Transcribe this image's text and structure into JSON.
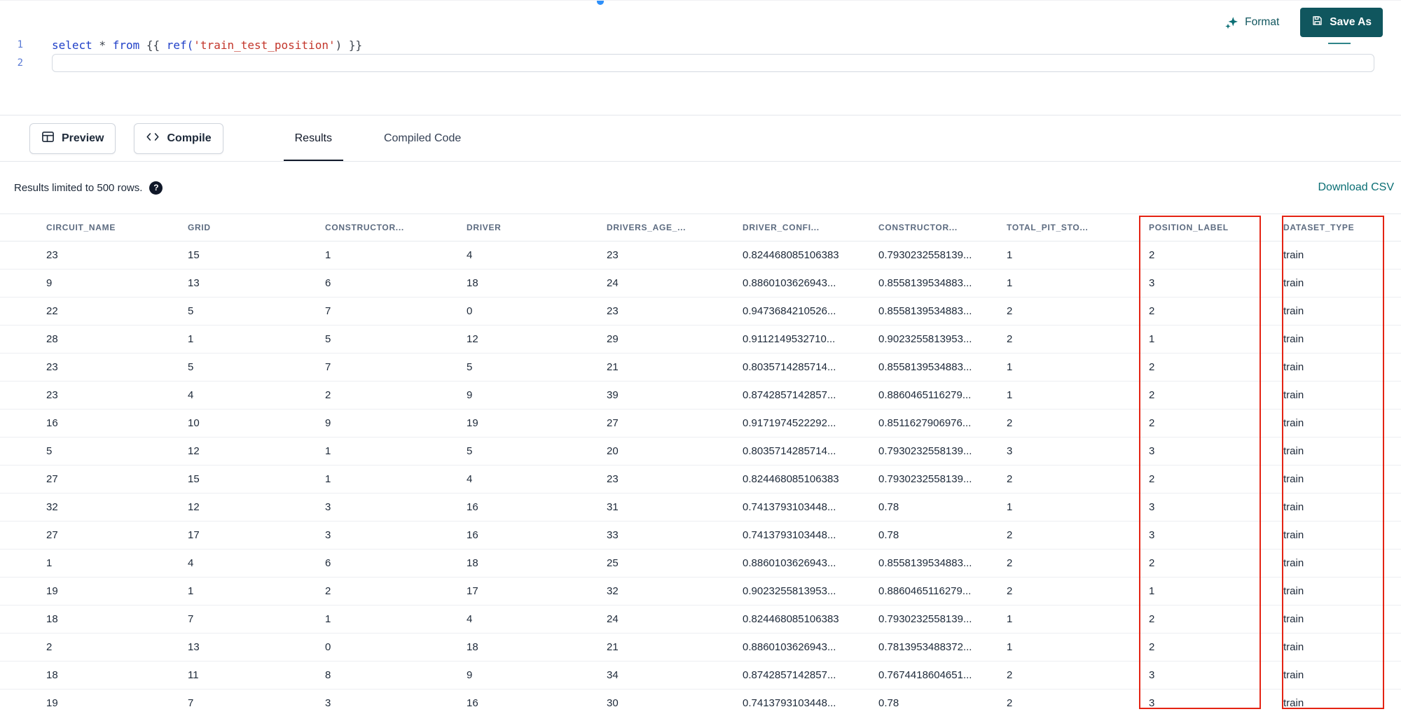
{
  "editor": {
    "actions": {
      "format_label": "Format",
      "save_as_label": "Save As"
    },
    "lines": [
      {
        "number": "1"
      },
      {
        "number": "2"
      }
    ],
    "code_tokens": [
      {
        "type": "keyword",
        "text": "select"
      },
      {
        "type": "plain",
        "text": " * "
      },
      {
        "type": "keyword",
        "text": "from"
      },
      {
        "type": "plain",
        "text": " {{ "
      },
      {
        "type": "function",
        "text": "ref("
      },
      {
        "type": "string",
        "text": "'train_test_position'"
      },
      {
        "type": "plain",
        "text": ") }}"
      }
    ]
  },
  "toolbar": {
    "preview_label": "Preview",
    "compile_label": "Compile",
    "tabs": [
      {
        "label": "Results",
        "active": true
      },
      {
        "label": "Compiled Code",
        "active": false
      }
    ]
  },
  "results": {
    "limit_note": "Results limited to 500 rows.",
    "help_icon": "?",
    "download_csv_label": "Download CSV",
    "columns": [
      "CIRCUIT_NAME",
      "GRID",
      "CONSTRUCTOR...",
      "DRIVER",
      "DRIVERS_AGE_...",
      "DRIVER_CONFI...",
      "CONSTRUCTOR...",
      "TOTAL_PIT_STO...",
      "POSITION_LABEL",
      "DATASET_TYPE"
    ],
    "rows": [
      [
        "23",
        "15",
        "1",
        "4",
        "23",
        "0.824468085106383",
        "0.7930232558139...",
        "1",
        "2",
        "train"
      ],
      [
        "9",
        "13",
        "6",
        "18",
        "24",
        "0.8860103626943...",
        "0.8558139534883...",
        "1",
        "3",
        "train"
      ],
      [
        "22",
        "5",
        "7",
        "0",
        "23",
        "0.9473684210526...",
        "0.8558139534883...",
        "2",
        "2",
        "train"
      ],
      [
        "28",
        "1",
        "5",
        "12",
        "29",
        "0.9112149532710...",
        "0.9023255813953...",
        "2",
        "1",
        "train"
      ],
      [
        "23",
        "5",
        "7",
        "5",
        "21",
        "0.8035714285714...",
        "0.8558139534883...",
        "1",
        "2",
        "train"
      ],
      [
        "23",
        "4",
        "2",
        "9",
        "39",
        "0.8742857142857...",
        "0.8860465116279...",
        "1",
        "2",
        "train"
      ],
      [
        "16",
        "10",
        "9",
        "19",
        "27",
        "0.9171974522292...",
        "0.8511627906976...",
        "2",
        "2",
        "train"
      ],
      [
        "5",
        "12",
        "1",
        "5",
        "20",
        "0.8035714285714...",
        "0.7930232558139...",
        "3",
        "3",
        "train"
      ],
      [
        "27",
        "15",
        "1",
        "4",
        "23",
        "0.824468085106383",
        "0.7930232558139...",
        "2",
        "2",
        "train"
      ],
      [
        "32",
        "12",
        "3",
        "16",
        "31",
        "0.7413793103448...",
        "0.78",
        "1",
        "3",
        "train"
      ],
      [
        "27",
        "17",
        "3",
        "16",
        "33",
        "0.7413793103448...",
        "0.78",
        "2",
        "3",
        "train"
      ],
      [
        "1",
        "4",
        "6",
        "18",
        "25",
        "0.8860103626943...",
        "0.8558139534883...",
        "2",
        "2",
        "train"
      ],
      [
        "19",
        "1",
        "2",
        "17",
        "32",
        "0.9023255813953...",
        "0.8860465116279...",
        "2",
        "1",
        "train"
      ],
      [
        "18",
        "7",
        "1",
        "4",
        "24",
        "0.824468085106383",
        "0.7930232558139...",
        "1",
        "2",
        "train"
      ],
      [
        "2",
        "13",
        "0",
        "18",
        "21",
        "0.8860103626943...",
        "0.7813953488372...",
        "1",
        "2",
        "train"
      ],
      [
        "18",
        "11",
        "8",
        "9",
        "34",
        "0.8742857142857...",
        "0.7674418604651...",
        "2",
        "3",
        "train"
      ],
      [
        "19",
        "7",
        "3",
        "16",
        "30",
        "0.7413793103448...",
        "0.78",
        "2",
        "3",
        "train"
      ]
    ],
    "highlighted_columns": [
      "POSITION_LABEL",
      "DATASET_TYPE"
    ]
  },
  "colors": {
    "accent_teal": "#0a6e74",
    "save_button": "#10565e",
    "annotation_red": "#e42313",
    "keyword_blue": "#2040c8",
    "string_red": "#c3362b",
    "line_number_blue": "#5b7bd5"
  }
}
